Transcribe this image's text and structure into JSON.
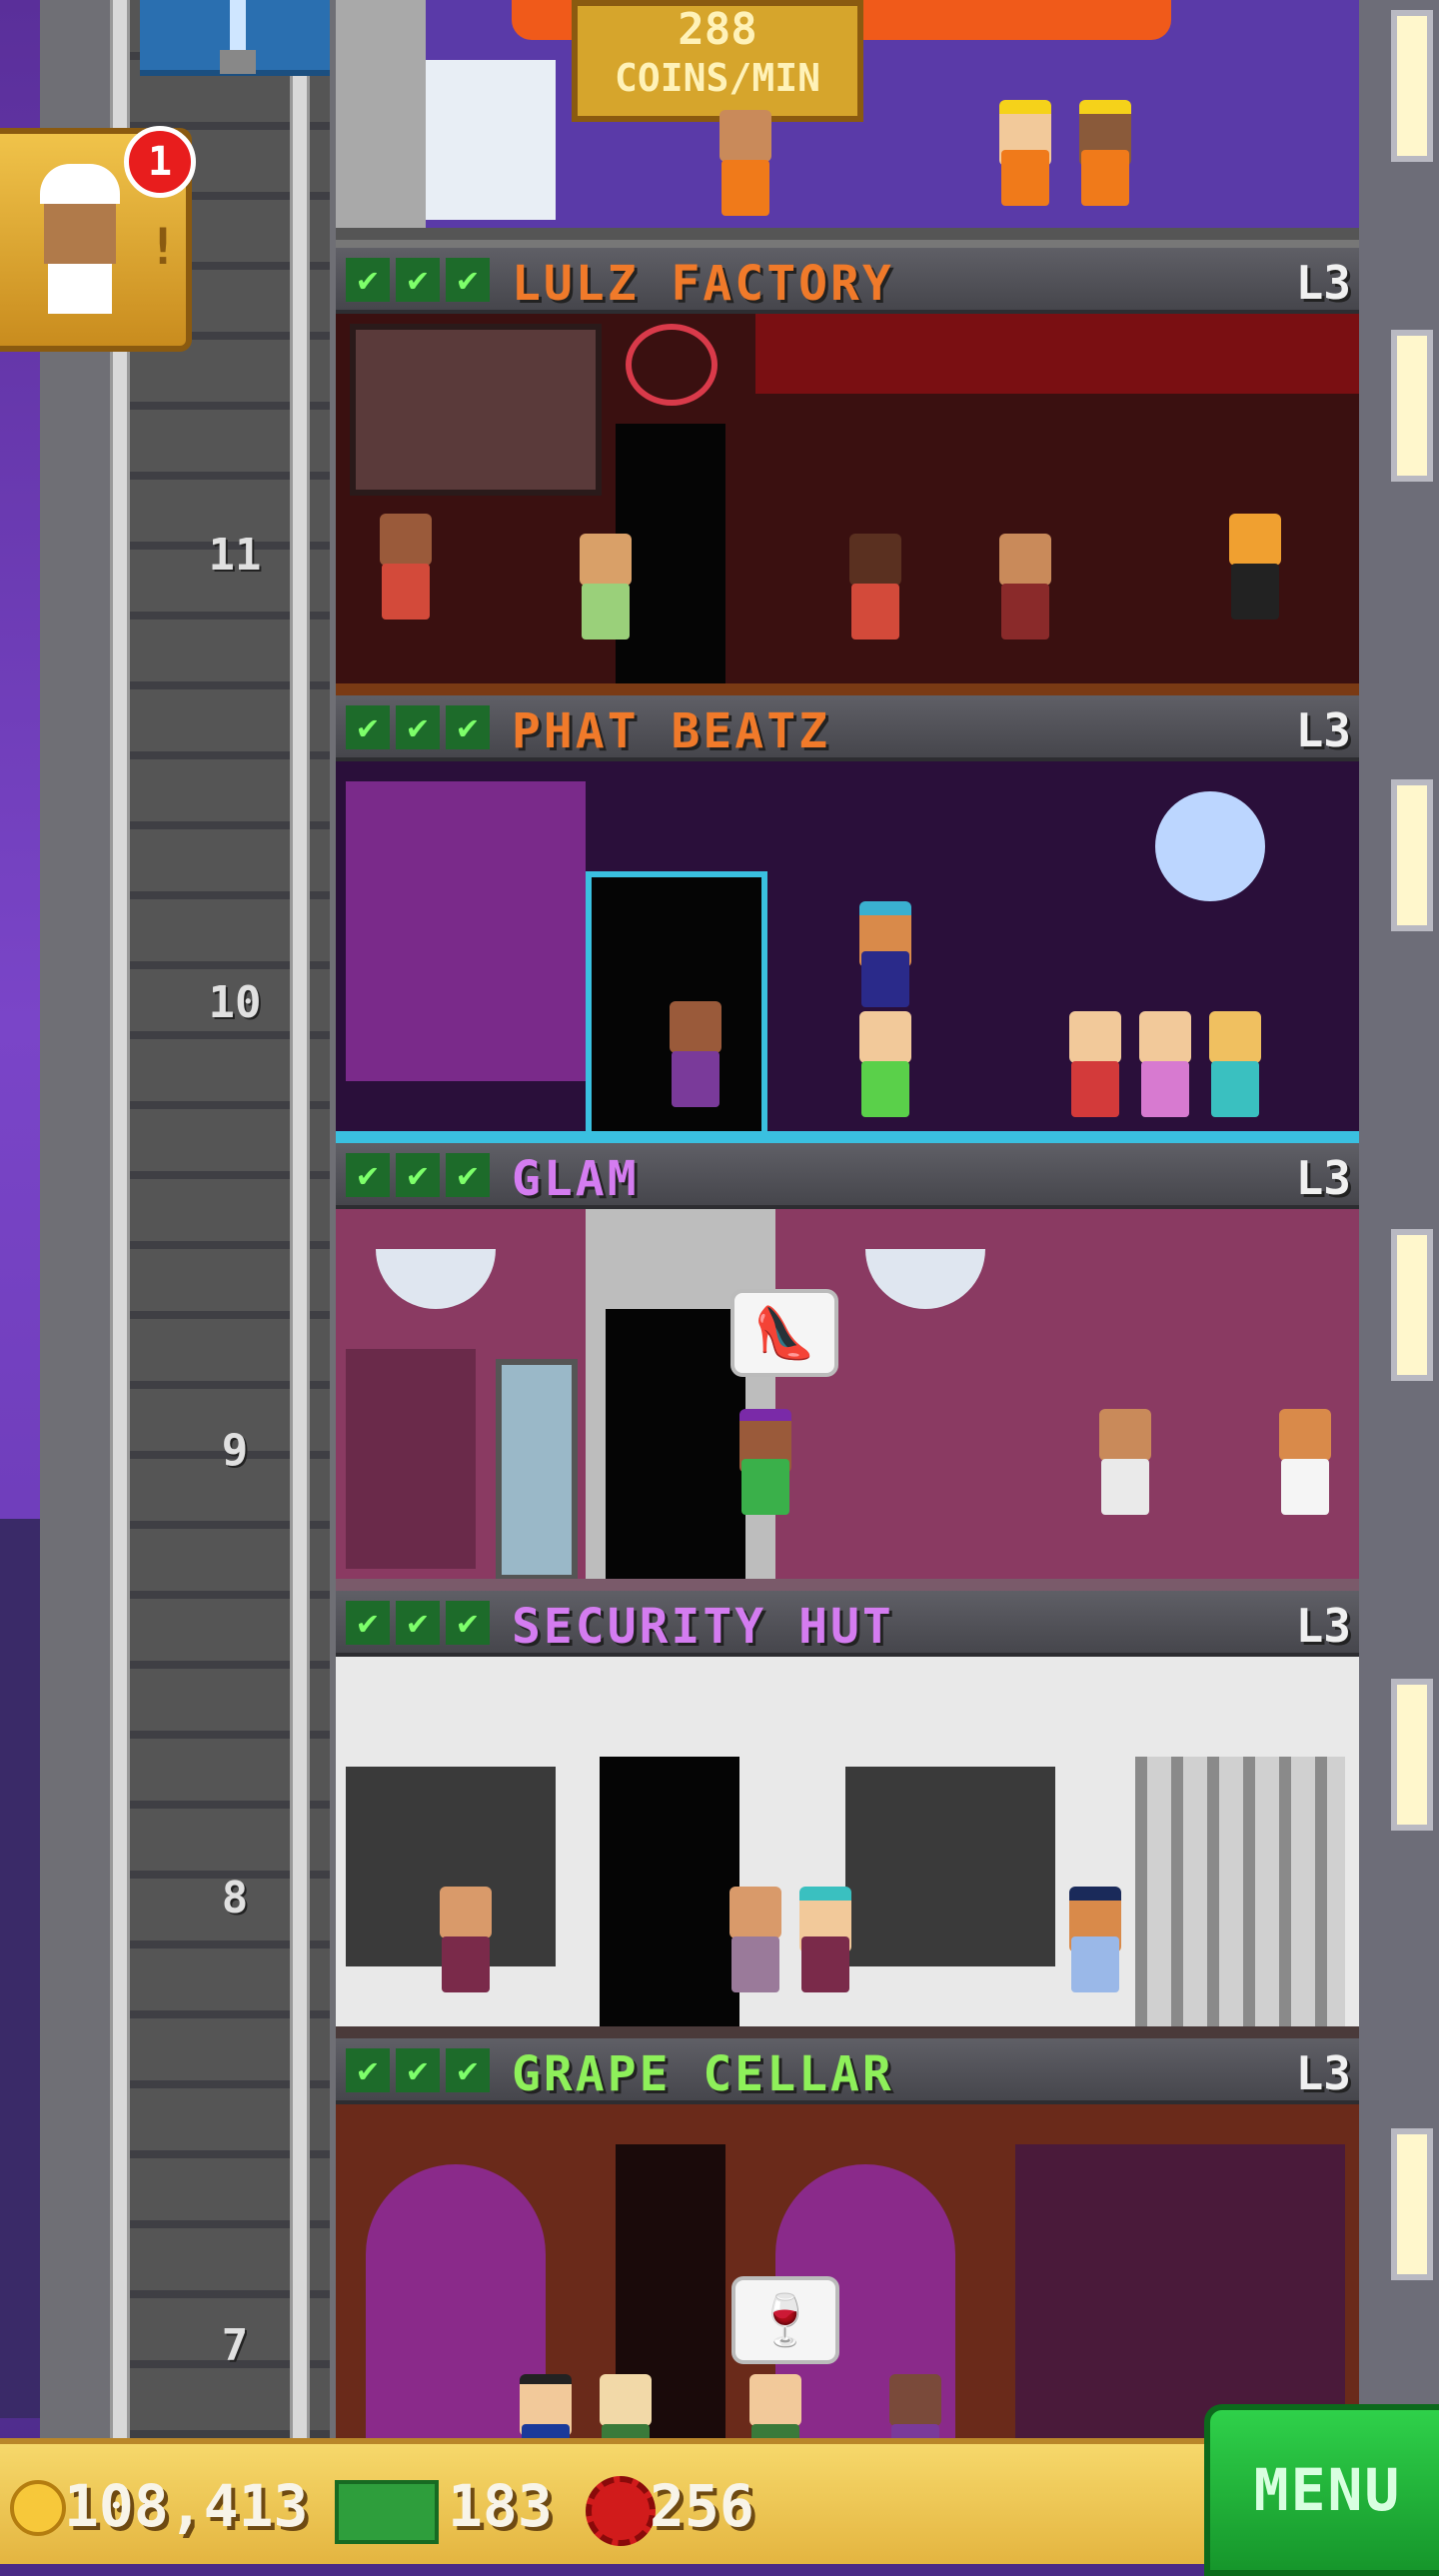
{
  "top_floor": {
    "coin_rate": "288",
    "coin_rate_unit": "COINS/MIN"
  },
  "notification": {
    "count": "1"
  },
  "floors": [
    {
      "name": "LULZ FACTORY",
      "level": "L3",
      "number": "11",
      "name_color": "#f07a2a",
      "room_bg": "#3a1010"
    },
    {
      "name": "PHAT BEATZ",
      "level": "L3",
      "number": "10",
      "name_color": "#f07a2a",
      "room_bg": "#2a0f3a"
    },
    {
      "name": "GLAM",
      "level": "L3",
      "number": "9",
      "name_color": "#d47cf0",
      "room_bg": "#8a3a62"
    },
    {
      "name": "SECURITY HUT",
      "level": "L3",
      "number": "8",
      "name_color": "#d47cf0",
      "room_bg": "#e9e9e9"
    },
    {
      "name": "GRAPE CELLAR",
      "level": "L3",
      "number": "7",
      "name_color": "#8ef05a",
      "room_bg": "#6a2a1a"
    }
  ],
  "checks": [
    "✔",
    "✔",
    "✔"
  ],
  "hud": {
    "coins": "108,413",
    "bux": "183",
    "tokens": "256",
    "menu_label": "MENU"
  },
  "bubbles": {
    "glam": "👠",
    "cellar": "🍷"
  },
  "colors": {
    "header": "#4f4f55",
    "hud_gold": "#f0c34a",
    "menu_green": "#22b83a"
  }
}
